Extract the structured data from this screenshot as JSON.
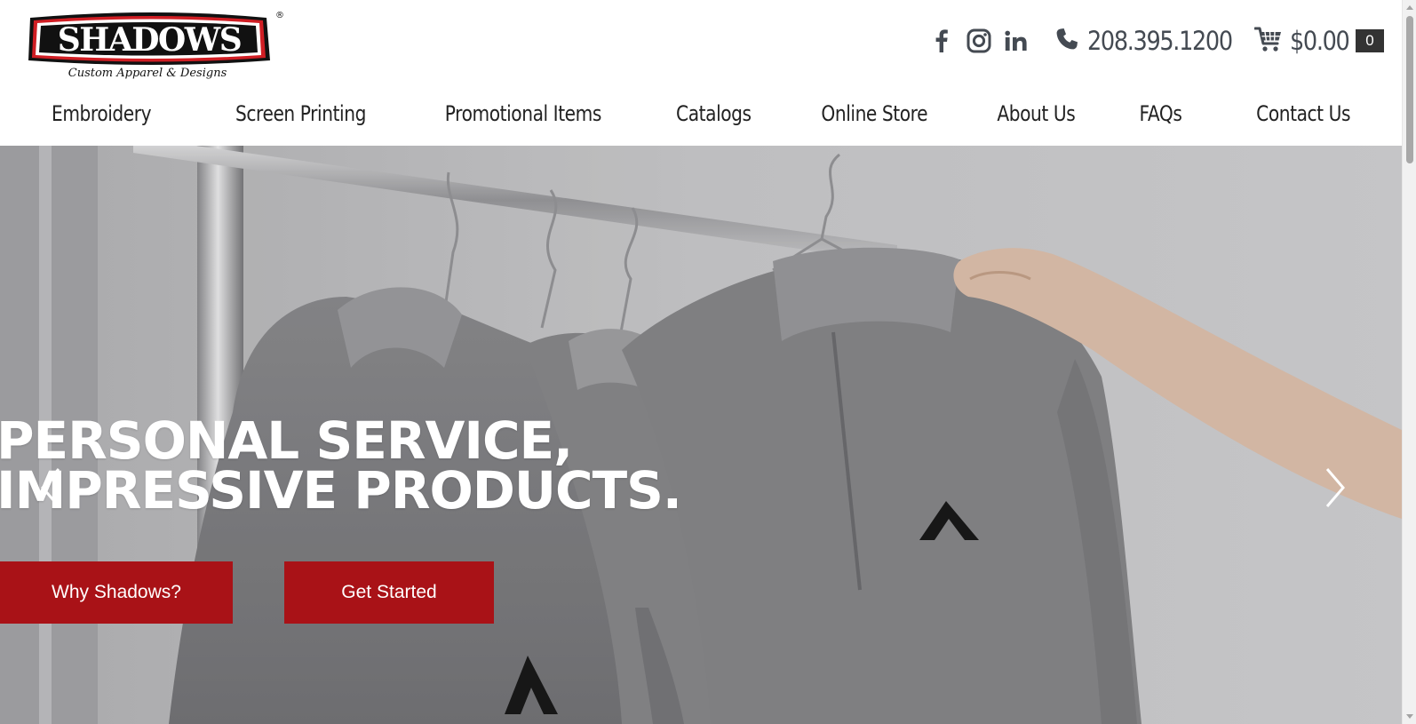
{
  "brand": {
    "name": "SHADOWS",
    "tagline": "Custom Apparel & Designs",
    "registered_mark": "®",
    "colors": {
      "red": "#a91217",
      "black": "#111111"
    }
  },
  "header": {
    "social": [
      {
        "icon": "facebook-icon",
        "label": "Facebook"
      },
      {
        "icon": "instagram-icon",
        "label": "Instagram"
      },
      {
        "icon": "linkedin-icon",
        "label": "LinkedIn"
      }
    ],
    "phone": "208.395.1200",
    "cart": {
      "total": "$0.00",
      "count": "0"
    }
  },
  "nav": {
    "items": [
      "Embroidery",
      "Screen Printing",
      "Promotional Items",
      "Catalogs",
      "Online Store",
      "About Us",
      "FAQs",
      "Contact Us"
    ]
  },
  "hero": {
    "headline_line1": "PERSONAL SERVICE,",
    "headline_line2": "IMPRESSIVE PRODUCTS.",
    "buttons": {
      "why": "Why Shadows?",
      "start": "Get Started"
    },
    "accent_color": "#a91217"
  }
}
